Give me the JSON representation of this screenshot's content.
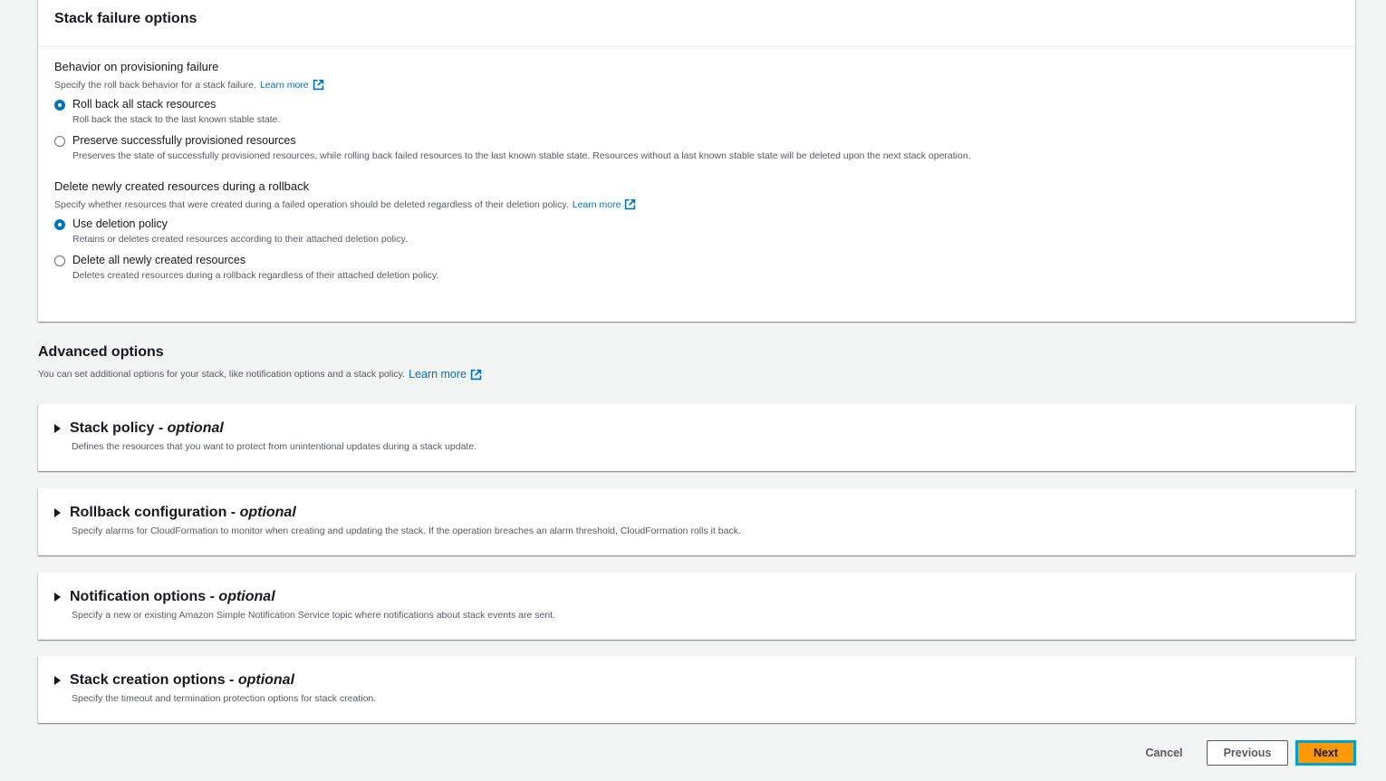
{
  "failure_panel": {
    "title": "Stack failure options",
    "group1": {
      "label": "Behavior on provisioning failure",
      "description": "Specify the roll back behavior for a stack failure.",
      "learn_more": "Learn more",
      "options": [
        {
          "label": "Roll back all stack resources",
          "description": "Roll back the stack to the last known stable state.",
          "checked": true
        },
        {
          "label": "Preserve successfully provisioned resources",
          "description": "Preserves the state of successfully provisioned resources, while rolling back failed resources to the last known stable state. Resources without a last known stable state will be deleted upon the next stack operation.",
          "checked": false
        }
      ]
    },
    "group2": {
      "label": "Delete newly created resources during a rollback",
      "description": "Specify whether resources that were created during a failed operation should be deleted regardless of their deletion policy.",
      "learn_more": "Learn more",
      "options": [
        {
          "label": "Use deletion policy",
          "description": "Retains or deletes created resources according to their attached deletion policy.",
          "checked": true
        },
        {
          "label": "Delete all newly created resources",
          "description": "Deletes created resources during a rollback regardless of their attached deletion policy.",
          "checked": false
        }
      ]
    }
  },
  "advanced": {
    "title": "Advanced options",
    "description": "You can set additional options for your stack, like notification options and a stack policy.",
    "learn_more": "Learn more",
    "panels": [
      {
        "title": "Stack policy - ",
        "optional": "optional",
        "description": "Defines the resources that you want to protect from unintentional updates during a stack update."
      },
      {
        "title": "Rollback configuration - ",
        "optional": "optional",
        "description": "Specify alarms for CloudFormation to monitor when creating and updating the stack. If the operation breaches an alarm threshold, CloudFormation rolls it back."
      },
      {
        "title": "Notification options - ",
        "optional": "optional",
        "description": "Specify a new or existing Amazon Simple Notification Service topic where notifications about stack events are sent."
      },
      {
        "title": "Stack creation options - ",
        "optional": "optional",
        "description": "Specify the timeout and termination protection options for stack creation."
      }
    ]
  },
  "footer": {
    "cancel": "Cancel",
    "previous": "Previous",
    "next": "Next"
  },
  "colors": {
    "link": "#0073bb",
    "primary_button": "#ff9900",
    "focus_ring": "#00a1c9"
  },
  "icons": {
    "external_link": "external-link-icon",
    "caret": "caret-right-icon"
  }
}
